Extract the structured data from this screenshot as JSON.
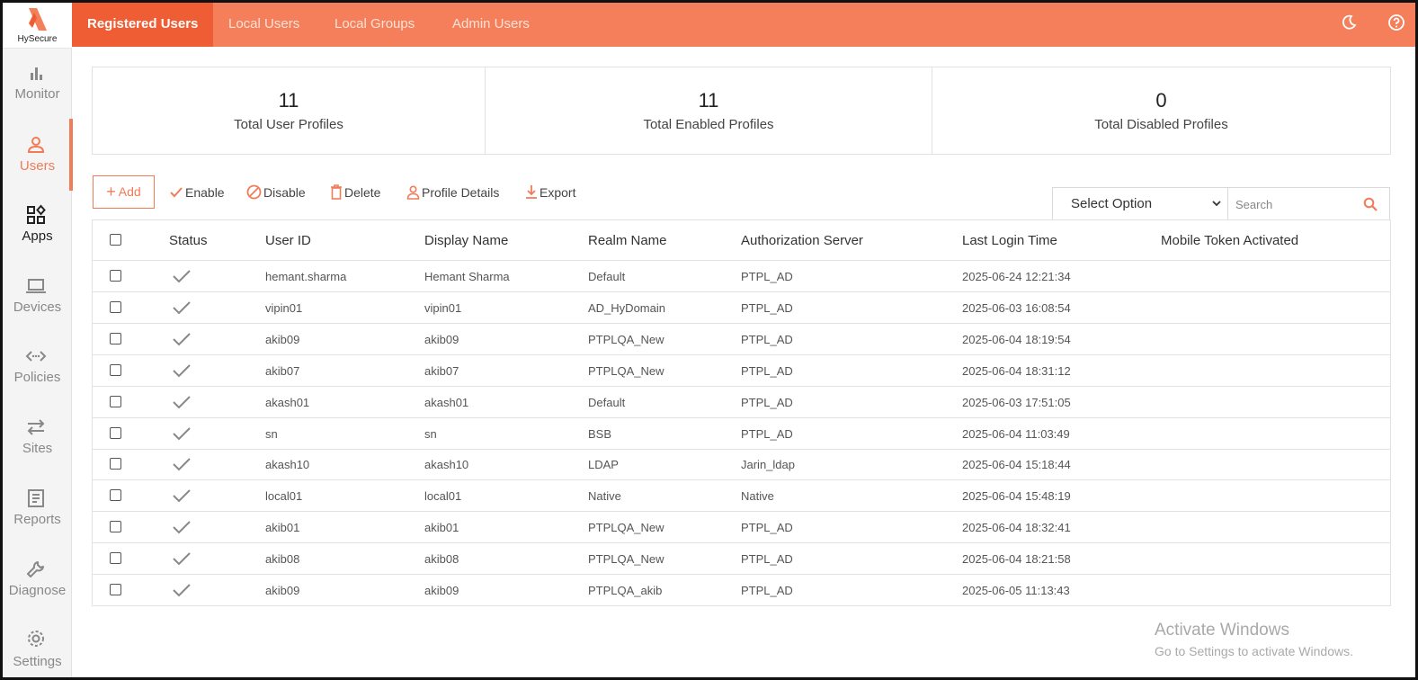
{
  "app": {
    "logo_text": "HySecure",
    "accent": "#f47f5a",
    "accent_dark": "#ee5d33"
  },
  "sidebar": {
    "items": [
      {
        "label": "Monitor",
        "icon": "bar-chart-icon"
      },
      {
        "label": "Users",
        "icon": "user-icon"
      },
      {
        "label": "Apps",
        "icon": "apps-grid-icon"
      },
      {
        "label": "Devices",
        "icon": "laptop-icon"
      },
      {
        "label": "Policies",
        "icon": "code-arrows-icon"
      },
      {
        "label": "Sites",
        "icon": "swap-arrows-icon"
      },
      {
        "label": "Reports",
        "icon": "report-icon"
      },
      {
        "label": "Diagnose",
        "icon": "wrench-icon"
      },
      {
        "label": "Settings",
        "icon": "gear-icon"
      }
    ]
  },
  "tabs": [
    {
      "label": "Registered Users"
    },
    {
      "label": "Local Users"
    },
    {
      "label": "Local Groups"
    },
    {
      "label": "Admin Users"
    }
  ],
  "top_icons": [
    "moon-icon",
    "help-icon"
  ],
  "stats": [
    {
      "value": "11",
      "caption": "Total User Profiles"
    },
    {
      "value": "11",
      "caption": "Total Enabled Profiles"
    },
    {
      "value": "0",
      "caption": "Total Disabled Profiles"
    }
  ],
  "toolbar": {
    "add": "Add",
    "enable": "Enable",
    "disable": "Disable",
    "delete": "Delete",
    "profile_details": "Profile Details",
    "export": "Export"
  },
  "filter": {
    "select_value": "Select Option",
    "search_placeholder": "Search"
  },
  "table": {
    "columns": [
      "Status",
      "User ID",
      "Display Name",
      "Realm Name",
      "Authorization Server",
      "Last Login Time",
      "Mobile Token Activated"
    ],
    "rows": [
      {
        "user_id": "hemant.sharma",
        "display_name": "Hemant Sharma",
        "realm": "Default",
        "auth_server": "PTPL_AD",
        "last_login": "2025-06-24 12:21:34",
        "mobile_token": ""
      },
      {
        "user_id": "vipin01",
        "display_name": "vipin01",
        "realm": "AD_HyDomain",
        "auth_server": "PTPL_AD",
        "last_login": "2025-06-03 16:08:54",
        "mobile_token": ""
      },
      {
        "user_id": "akib09",
        "display_name": "akib09",
        "realm": "PTPLQA_New",
        "auth_server": "PTPL_AD",
        "last_login": "2025-06-04 18:19:54",
        "mobile_token": ""
      },
      {
        "user_id": "akib07",
        "display_name": "akib07",
        "realm": "PTPLQA_New",
        "auth_server": "PTPL_AD",
        "last_login": "2025-06-04 18:31:12",
        "mobile_token": ""
      },
      {
        "user_id": "akash01",
        "display_name": "akash01",
        "realm": "Default",
        "auth_server": "PTPL_AD",
        "last_login": "2025-06-03 17:51:05",
        "mobile_token": ""
      },
      {
        "user_id": "sn",
        "display_name": "sn",
        "realm": "BSB",
        "auth_server": "PTPL_AD",
        "last_login": "2025-06-04 11:03:49",
        "mobile_token": ""
      },
      {
        "user_id": "akash10",
        "display_name": "akash10",
        "realm": "LDAP",
        "auth_server": "Jarin_ldap",
        "last_login": "2025-06-04 15:18:44",
        "mobile_token": ""
      },
      {
        "user_id": "local01",
        "display_name": "local01",
        "realm": "Native",
        "auth_server": "Native",
        "last_login": "2025-06-04 15:48:19",
        "mobile_token": ""
      },
      {
        "user_id": "akib01",
        "display_name": "akib01",
        "realm": "PTPLQA_New",
        "auth_server": "PTPL_AD",
        "last_login": "2025-06-04 18:32:41",
        "mobile_token": ""
      },
      {
        "user_id": "akib08",
        "display_name": "akib08",
        "realm": "PTPLQA_New",
        "auth_server": "PTPL_AD",
        "last_login": "2025-06-04 18:21:58",
        "mobile_token": ""
      },
      {
        "user_id": "akib09",
        "display_name": "akib09",
        "realm": "PTPLQA_akib",
        "auth_server": "PTPL_AD",
        "last_login": "2025-06-05 11:13:43",
        "mobile_token": ""
      }
    ]
  },
  "watermark": {
    "title": "Activate Windows",
    "subtitle": "Go to Settings to activate Windows."
  }
}
